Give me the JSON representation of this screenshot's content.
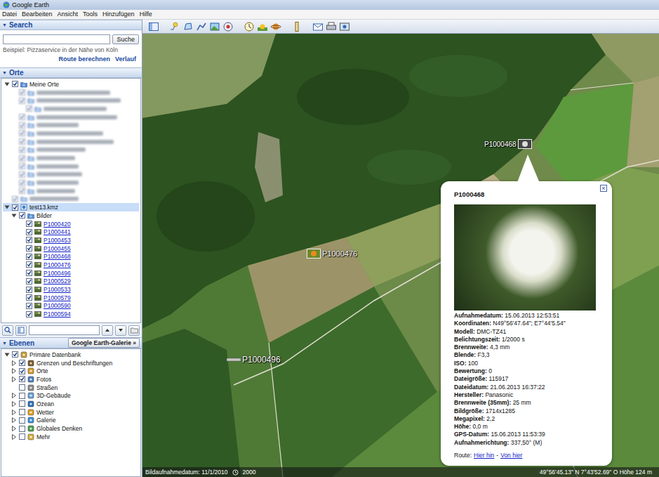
{
  "window": {
    "title": "Google Earth"
  },
  "menu": [
    "Datei",
    "Bearbeiten",
    "Ansicht",
    "Tools",
    "Hinzufügen",
    "Hilfe"
  ],
  "search": {
    "title": "Search",
    "arrow": "▼",
    "expanded": true,
    "value": "",
    "button": "Suche",
    "example": "Beispiel: Pizzaservice in der Nähe von Köln",
    "links": [
      "Route berechnen",
      "Verlauf"
    ]
  },
  "places": {
    "title": "Orte",
    "arrow": "▼",
    "expanded": true,
    "items": [
      {
        "kind": "folder",
        "label": "Meine Orte",
        "depth": 0,
        "checked": true,
        "expanded": true,
        "selected": false
      },
      {
        "kind": "blurred",
        "depth": 1,
        "checked": true,
        "selected": false
      },
      {
        "kind": "blurred",
        "depth": 1,
        "checked": true,
        "selected": false
      },
      {
        "kind": "blurred",
        "depth": 2,
        "checked": true,
        "selected": false
      },
      {
        "kind": "blurred",
        "depth": 1,
        "checked": true,
        "selected": false
      },
      {
        "kind": "blurred",
        "depth": 1,
        "checked": true,
        "selected": false
      },
      {
        "kind": "blurred",
        "depth": 1,
        "checked": true,
        "selected": false
      },
      {
        "kind": "blurred",
        "depth": 1,
        "checked": true,
        "selected": false
      },
      {
        "kind": "blurred",
        "depth": 1,
        "checked": true,
        "selected": false
      },
      {
        "kind": "blurred",
        "depth": 1,
        "checked": true,
        "selected": false
      },
      {
        "kind": "blurred",
        "depth": 1,
        "checked": true,
        "selected": false
      },
      {
        "kind": "blurred",
        "depth": 1,
        "checked": true,
        "selected": false
      },
      {
        "kind": "blurred",
        "depth": 1,
        "checked": true,
        "selected": false
      },
      {
        "kind": "blurred",
        "depth": 1,
        "checked": true,
        "selected": false
      },
      {
        "kind": "blurred",
        "depth": 0,
        "checked": true,
        "selected": false
      },
      {
        "kind": "kmz",
        "label": "test13.kmz",
        "depth": 0,
        "checked": true,
        "expanded": true,
        "selected": true
      },
      {
        "kind": "folder",
        "label": "Bilder",
        "depth": 1,
        "checked": true,
        "expanded": true,
        "selected": false
      },
      {
        "kind": "photo",
        "label": "P1000420",
        "depth": 2,
        "checked": true,
        "selected": false
      },
      {
        "kind": "photo",
        "label": "P1000441",
        "depth": 2,
        "checked": true,
        "selected": false
      },
      {
        "kind": "photo",
        "label": "P1000453",
        "depth": 2,
        "checked": true,
        "selected": false
      },
      {
        "kind": "photo",
        "label": "P1000455",
        "depth": 2,
        "checked": true,
        "selected": false
      },
      {
        "kind": "photo",
        "label": "P1000468",
        "depth": 2,
        "checked": true,
        "selected": false
      },
      {
        "kind": "photo",
        "label": "P1000476",
        "depth": 2,
        "checked": true,
        "selected": false
      },
      {
        "kind": "photo",
        "label": "P1000496",
        "depth": 2,
        "checked": true,
        "selected": false
      },
      {
        "kind": "photo",
        "label": "P1000529",
        "depth": 2,
        "checked": true,
        "selected": false
      },
      {
        "kind": "photo",
        "label": "P1000533",
        "depth": 2,
        "checked": true,
        "selected": false
      },
      {
        "kind": "photo",
        "label": "P1000579",
        "depth": 2,
        "checked": true,
        "selected": false
      },
      {
        "kind": "photo",
        "label": "P1000590",
        "depth": 2,
        "checked": true,
        "selected": false
      },
      {
        "kind": "photo",
        "label": "P1000594",
        "depth": 2,
        "checked": true,
        "selected": false
      }
    ]
  },
  "layers": {
    "title": "Ebenen",
    "arrow": "▼",
    "expanded": true,
    "gallery_button": "Google Earth-Galerie »",
    "items": [
      {
        "kind": "database",
        "label": "Primäre Datenbank",
        "depth": 0,
        "checked": true,
        "expanded": true,
        "selected": false
      },
      {
        "kind": "borders",
        "label": "Grenzen und Beschriftungen",
        "depth": 1,
        "checked": true,
        "expanded": false,
        "selected": false
      },
      {
        "kind": "places",
        "label": "Orte",
        "depth": 1,
        "checked": true,
        "expanded": false,
        "selected": false
      },
      {
        "kind": "photos",
        "label": "Fotos",
        "depth": 1,
        "checked": true,
        "expanded": false,
        "selected": false
      },
      {
        "kind": "roads",
        "label": "Straßen",
        "depth": 1,
        "checked": false,
        "selected": false
      },
      {
        "kind": "buildings",
        "label": "3D-Gebäude",
        "depth": 1,
        "checked": false,
        "expanded": false,
        "selected": false
      },
      {
        "kind": "ocean",
        "label": "Ozean",
        "depth": 1,
        "checked": false,
        "expanded": false,
        "selected": false
      },
      {
        "kind": "weather",
        "label": "Wetter",
        "depth": 1,
        "checked": false,
        "expanded": false,
        "selected": false
      },
      {
        "kind": "gallery",
        "label": "Galerie",
        "depth": 1,
        "checked": false,
        "expanded": false,
        "selected": false
      },
      {
        "kind": "global",
        "label": "Globales Denken",
        "depth": 1,
        "checked": false,
        "expanded": false,
        "selected": false
      },
      {
        "kind": "more",
        "label": "Mehr",
        "depth": 1,
        "checked": false,
        "expanded": false,
        "selected": false
      }
    ]
  },
  "map": {
    "pins": [
      {
        "label": "P1000476"
      },
      {
        "label": "P1000496"
      },
      {
        "label": "P1000468"
      }
    ],
    "balloon": {
      "title": "P1000468",
      "close": "×",
      "fields": [
        {
          "label": "Aufnahmedatum:",
          "value": "15.06.2013 12:53:51"
        },
        {
          "label": "Koordinaten:",
          "value": "N49°56'47.64\"; E7°44'5.54\""
        },
        {
          "label": "Modell:",
          "value": "DMC-TZ41"
        },
        {
          "label": "Belichtungszeit:",
          "value": "1/2000 s"
        },
        {
          "label": "Brennweite:",
          "value": "4,3 mm"
        },
        {
          "label": "Blende:",
          "value": "F3,3"
        },
        {
          "label": "ISO:",
          "value": "100"
        },
        {
          "label": "Bewertung:",
          "value": "0"
        },
        {
          "label": "Dateigröße:",
          "value": "115917"
        },
        {
          "label": "Dateidatum:",
          "value": "21.06.2013 16:37:22"
        },
        {
          "label": "Hersteller:",
          "value": "Panasonic"
        },
        {
          "label": "Brennweite (35mm):",
          "value": "25 mm"
        },
        {
          "label": "Bildgröße:",
          "value": "1714x1285"
        },
        {
          "label": "Megapixel:",
          "value": "2,2"
        },
        {
          "label": "Höhe:",
          "value": "0,0 m"
        },
        {
          "label": "GPS-Datum:",
          "value": "15.06.2013 11:53:39"
        },
        {
          "label": "Aufnahmerichtung:",
          "value": "337,50° (M)"
        }
      ],
      "route": {
        "label": "Route:",
        "links": [
          "Hier hin",
          "Von hier"
        ],
        "separator": "-"
      }
    },
    "status": {
      "imagery_date": "Bildaufnahmedatum: 11/1/2010",
      "year": "2000",
      "position": "49°56'45.13\" N  7°43'52.69\" O  Höhe  124 m"
    }
  }
}
